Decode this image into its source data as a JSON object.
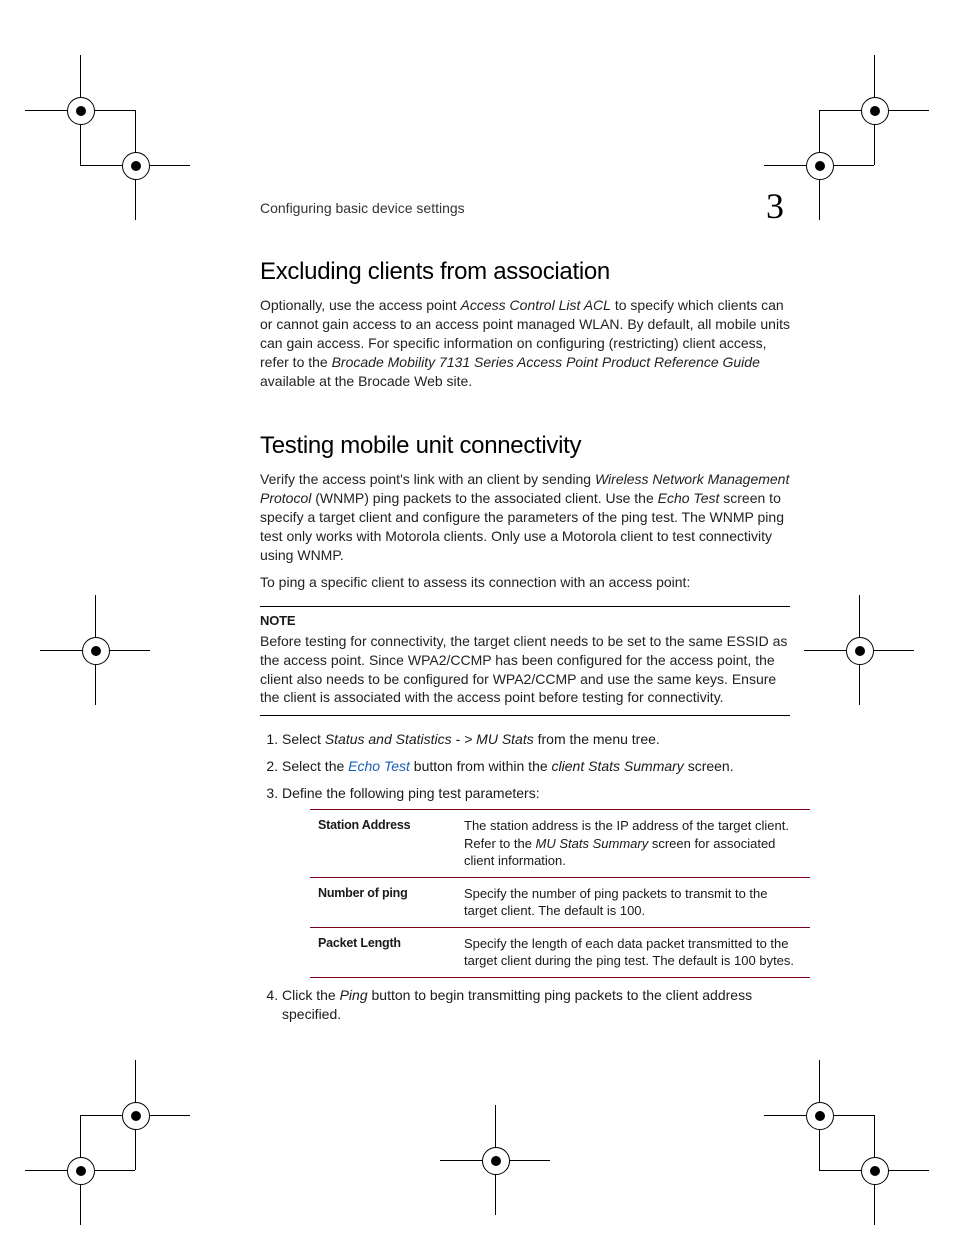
{
  "header": {
    "running_title": "Configuring basic device settings",
    "chapter_number": "3"
  },
  "section1": {
    "heading": "Excluding clients from association",
    "para1_pre": "Optionally, use the access point ",
    "para1_em1": "Access Control List ACL",
    "para1_mid1": " to specify which clients can or cannot gain access to an access point managed WLAN. By default, all mobile units can gain access. For specific information on configuring (restricting) client access, refer to the ",
    "para1_em2": "Brocade Mobility 7131 Series Access Point Product Reference Guide",
    "para1_post": " available at the Brocade Web site."
  },
  "section2": {
    "heading": "Testing mobile unit connectivity",
    "para1_pre": "Verify the access point's link with an client by sending ",
    "para1_em1": "Wireless Network Management Protocol",
    "para1_mid1": " (WNMP) ping packets to the associated client. Use the ",
    "para1_em2": "Echo Test",
    "para1_mid2": " screen to specify a target client and configure the parameters of the ping test. The WNMP ping test only works with Motorola clients. Only use a Motorola client to test connectivity using WNMP.",
    "para2": "To ping a specific client to assess its connection with an access point:",
    "note_label": "NOTE",
    "note_body": "Before testing for connectivity, the target client needs to be set to the same ESSID as the access point. Since WPA2/CCMP has been configured for the access point, the client also needs to be configured for WPA2/CCMP and use the same keys. Ensure the client is associated with the access point before testing for connectivity.",
    "step1_pre": "Select ",
    "step1_em": "Status and Statistics - > MU Stats",
    "step1_post": " from the menu tree.",
    "step2_pre": "Select the ",
    "step2_link": "Echo Test",
    "step2_mid": " button from within the ",
    "step2_em": "client Stats Summary",
    "step2_post": " screen.",
    "step3": "Define the following ping test parameters:",
    "table": {
      "rows": [
        {
          "k": "Station Address",
          "v_pre": "The station address is the IP address of the target client. Refer to the ",
          "v_em": "MU Stats Summary",
          "v_post": " screen for associated client information."
        },
        {
          "k": "Number of ping",
          "v_pre": "Specify the number of ping packets to transmit to the target client. The default is 100.",
          "v_em": "",
          "v_post": ""
        },
        {
          "k": "Packet Length",
          "v_pre": "Specify the length of each data packet transmitted to the target client during the ping test. The default is 100 bytes.",
          "v_em": "",
          "v_post": ""
        }
      ]
    },
    "step4_pre": "Click the ",
    "step4_em": "Ping",
    "step4_post": " button to begin transmitting ping packets to the client address specified."
  }
}
